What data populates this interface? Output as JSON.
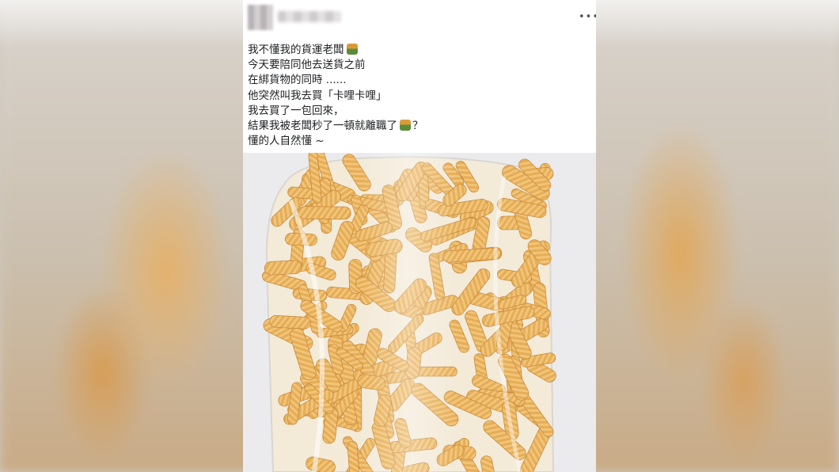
{
  "post": {
    "author_name": "",
    "more_options_icon": "more-horizontal-icon",
    "lines": [
      "我不懂我的貨運老闆",
      "今天要陪同他去送貨之前",
      "在綁貨物的同時 ......",
      "他突然叫我去買「卡哩卡哩」",
      "我去買了一包回來，",
      "結果我被老闆秒了一頓就離職了",
      "懂的人自然懂 ~"
    ],
    "line6_suffix": "？",
    "emoji_icon": "person-gesturing-no-icon",
    "photo_subject": "卡哩卡哩"
  },
  "colors": {
    "text": "#1c1e21",
    "card_background": "#ffffff",
    "snack": "#e2a84e"
  }
}
